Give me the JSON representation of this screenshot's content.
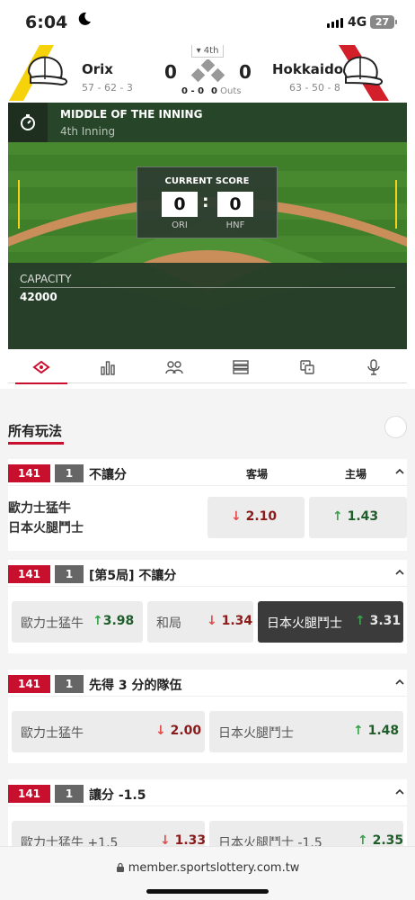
{
  "status": {
    "time": "6:04",
    "network": "4G",
    "battery": "27"
  },
  "game": {
    "inning_tag": "4th",
    "away": {
      "name": "Orix",
      "record": "57 - 62 - 3",
      "score": "0"
    },
    "home": {
      "name": "Hokkaido",
      "record": "63 - 50 - 8",
      "score": "0"
    },
    "count": "0 - 0",
    "outs_num": "0",
    "outs_label": "Outs"
  },
  "field": {
    "state_title": "MIDDLE OF THE INNING",
    "state_sub": "4th Inning",
    "current_score_title": "CURRENT SCORE",
    "away_score": "0",
    "home_score": "0",
    "away_abbr": "ORI",
    "home_abbr": "HNF",
    "capacity_label": "CAPACITY",
    "capacity_value": "42000"
  },
  "tabs": [
    "field-icon",
    "stats-icon",
    "lineup-icon",
    "list-icon",
    "dice-icon",
    "mic-icon"
  ],
  "section_title": "所有玩法",
  "markets": [
    {
      "code": "141",
      "num": "1",
      "title": "不讓分",
      "col_away": "客場",
      "col_home": "主場",
      "team_a": "歐力士猛牛",
      "team_b": "日本火腿鬥士",
      "odds": [
        {
          "value": "2.10",
          "dir": "down"
        },
        {
          "value": "1.43",
          "dir": "up"
        }
      ]
    },
    {
      "code": "141",
      "num": "1",
      "title": "[第5局] 不讓分",
      "odds": [
        {
          "name": "歐力士猛牛",
          "value": "3.98",
          "dir": "up"
        },
        {
          "name": "和局",
          "value": "1.34",
          "dir": "down"
        },
        {
          "name": "日本火腿鬥士",
          "value": "3.31",
          "dir": "up"
        }
      ]
    },
    {
      "code": "141",
      "num": "1",
      "title": "先得 3 分的隊伍",
      "odds": [
        {
          "name": "歐力士猛牛",
          "value": "2.00",
          "dir": "down"
        },
        {
          "name": "日本火腿鬥士",
          "value": "1.48",
          "dir": "up"
        }
      ]
    },
    {
      "code": "141",
      "num": "1",
      "title": "讓分 -1.5",
      "odds": [
        {
          "name": "歐力士猛牛 +1.5",
          "value": "1.33",
          "dir": "down"
        },
        {
          "name": "日本火腿鬥士 -1.5",
          "value": "2.35",
          "dir": "up"
        }
      ]
    }
  ],
  "arrows": {
    "up": "↑",
    "down": "↓"
  },
  "url": "member.sportslottery.com.tw"
}
